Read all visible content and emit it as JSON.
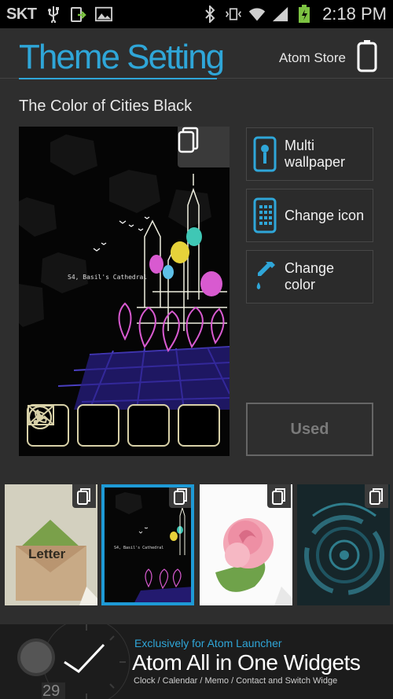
{
  "status_bar": {
    "carrier": "SKT",
    "time": "2:18 PM",
    "icons": [
      "usb-icon",
      "upload-icon",
      "image-icon",
      "bluetooth-icon",
      "vibrate-icon",
      "wifi-icon",
      "signal-icon",
      "battery-charging-icon"
    ]
  },
  "header": {
    "title": "Theme Setting",
    "store_label": "Atom Store",
    "store_icon": "phone-icon"
  },
  "theme": {
    "name": "The Color of Cities Black",
    "preview_caption": "S4, Basil's Cathedral",
    "dock_icons": [
      "mail-icon",
      "music-icon",
      "phone-call-icon",
      "play-icon"
    ]
  },
  "actions": [
    {
      "label": "Multi\nwallpaper",
      "icon": "wallpaper-icon"
    },
    {
      "label": "Change icon",
      "icon": "grid-icon"
    },
    {
      "label": "Change\ncolor",
      "icon": "dropper-icon"
    }
  ],
  "used_label": "Used",
  "thumbnails": [
    {
      "name": "letter",
      "text": "Letter",
      "selected": false
    },
    {
      "name": "cities-black",
      "text": "S4, Basil's Cathedral",
      "selected": true
    },
    {
      "name": "rose",
      "text": "",
      "selected": false
    },
    {
      "name": "circles",
      "text": "",
      "selected": false
    }
  ],
  "banner": {
    "subtitle": "Exclusively for Atom Launcher",
    "title": "Atom All in One Widgets",
    "description": "Clock / Calendar / Memo / Contact and Switch Widge",
    "calendar_day": "29"
  },
  "colors": {
    "accent": "#2fa6d8",
    "background": "#2e2e2e",
    "selected_border": "#1e9ad6"
  }
}
